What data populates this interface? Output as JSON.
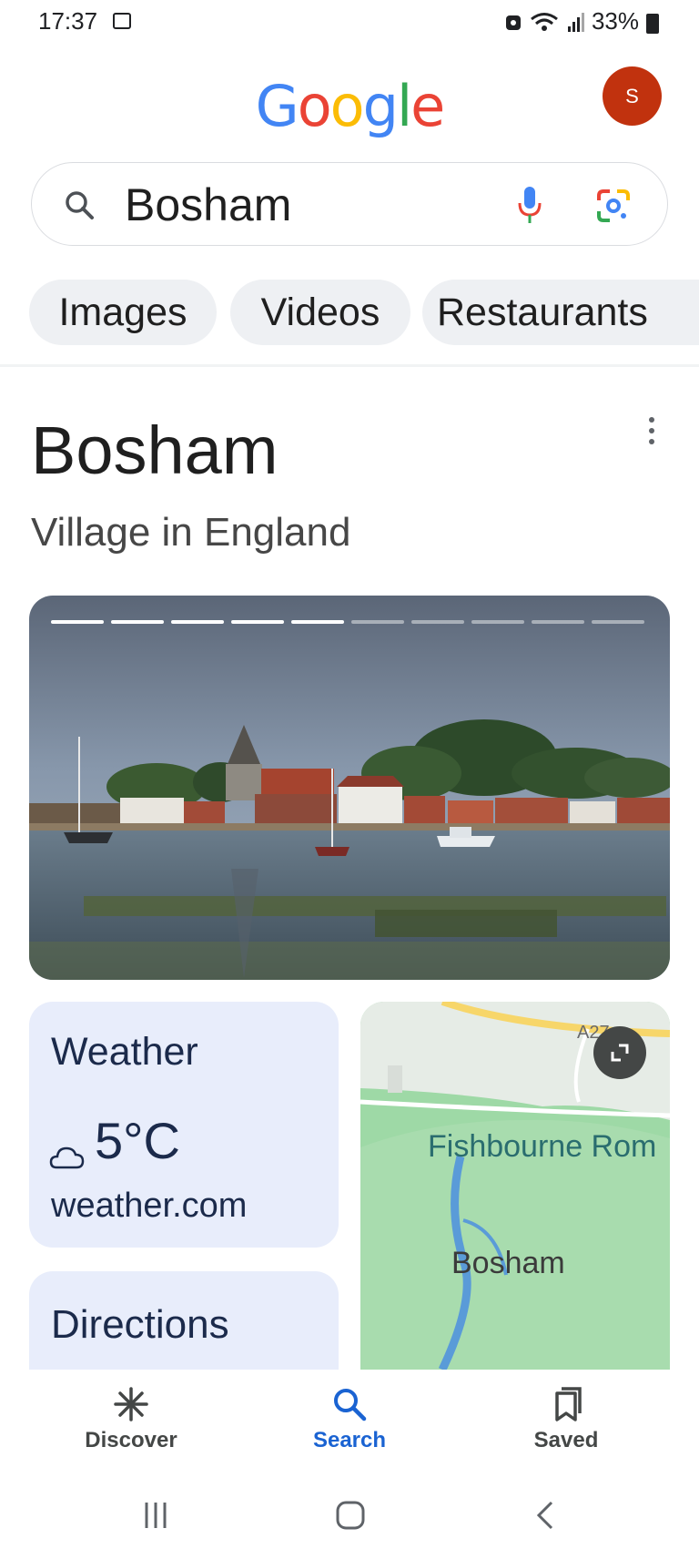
{
  "status_bar": {
    "time": "17:37",
    "battery": "33%"
  },
  "google_logo": {
    "letters": [
      "G",
      "o",
      "o",
      "g",
      "l",
      "e"
    ],
    "colors": [
      "#4285F4",
      "#EA4335",
      "#FBBC05",
      "#4285F4",
      "#34A853",
      "#EA4335"
    ]
  },
  "account": {
    "initial": "S",
    "color": "#c1320e"
  },
  "search": {
    "query": "Bosham"
  },
  "chips": [
    "Images",
    "Videos",
    "Restaurants"
  ],
  "knowledge_panel": {
    "title": "Bosham",
    "subtitle": "Village in England",
    "carousel": {
      "total_images": 10,
      "current_image": 5
    }
  },
  "weather": {
    "title": "Weather",
    "temperature": "5°C",
    "source": "weather.com",
    "icon": "cloud-icon"
  },
  "directions": {
    "title": "Directions"
  },
  "map": {
    "labels": {
      "road": "A27",
      "place1": "Fishbourne Rom",
      "place2": "Bosham"
    }
  },
  "bottom_nav": {
    "items": [
      {
        "label": "Discover",
        "icon": "asterisk-icon"
      },
      {
        "label": "Search",
        "icon": "search-icon",
        "active": true
      },
      {
        "label": "Saved",
        "icon": "bookmarks-icon"
      }
    ]
  },
  "colors": {
    "accent": "#1a63d2",
    "card_bg": "#e8edfb",
    "map_green": "#9ed9a6"
  }
}
